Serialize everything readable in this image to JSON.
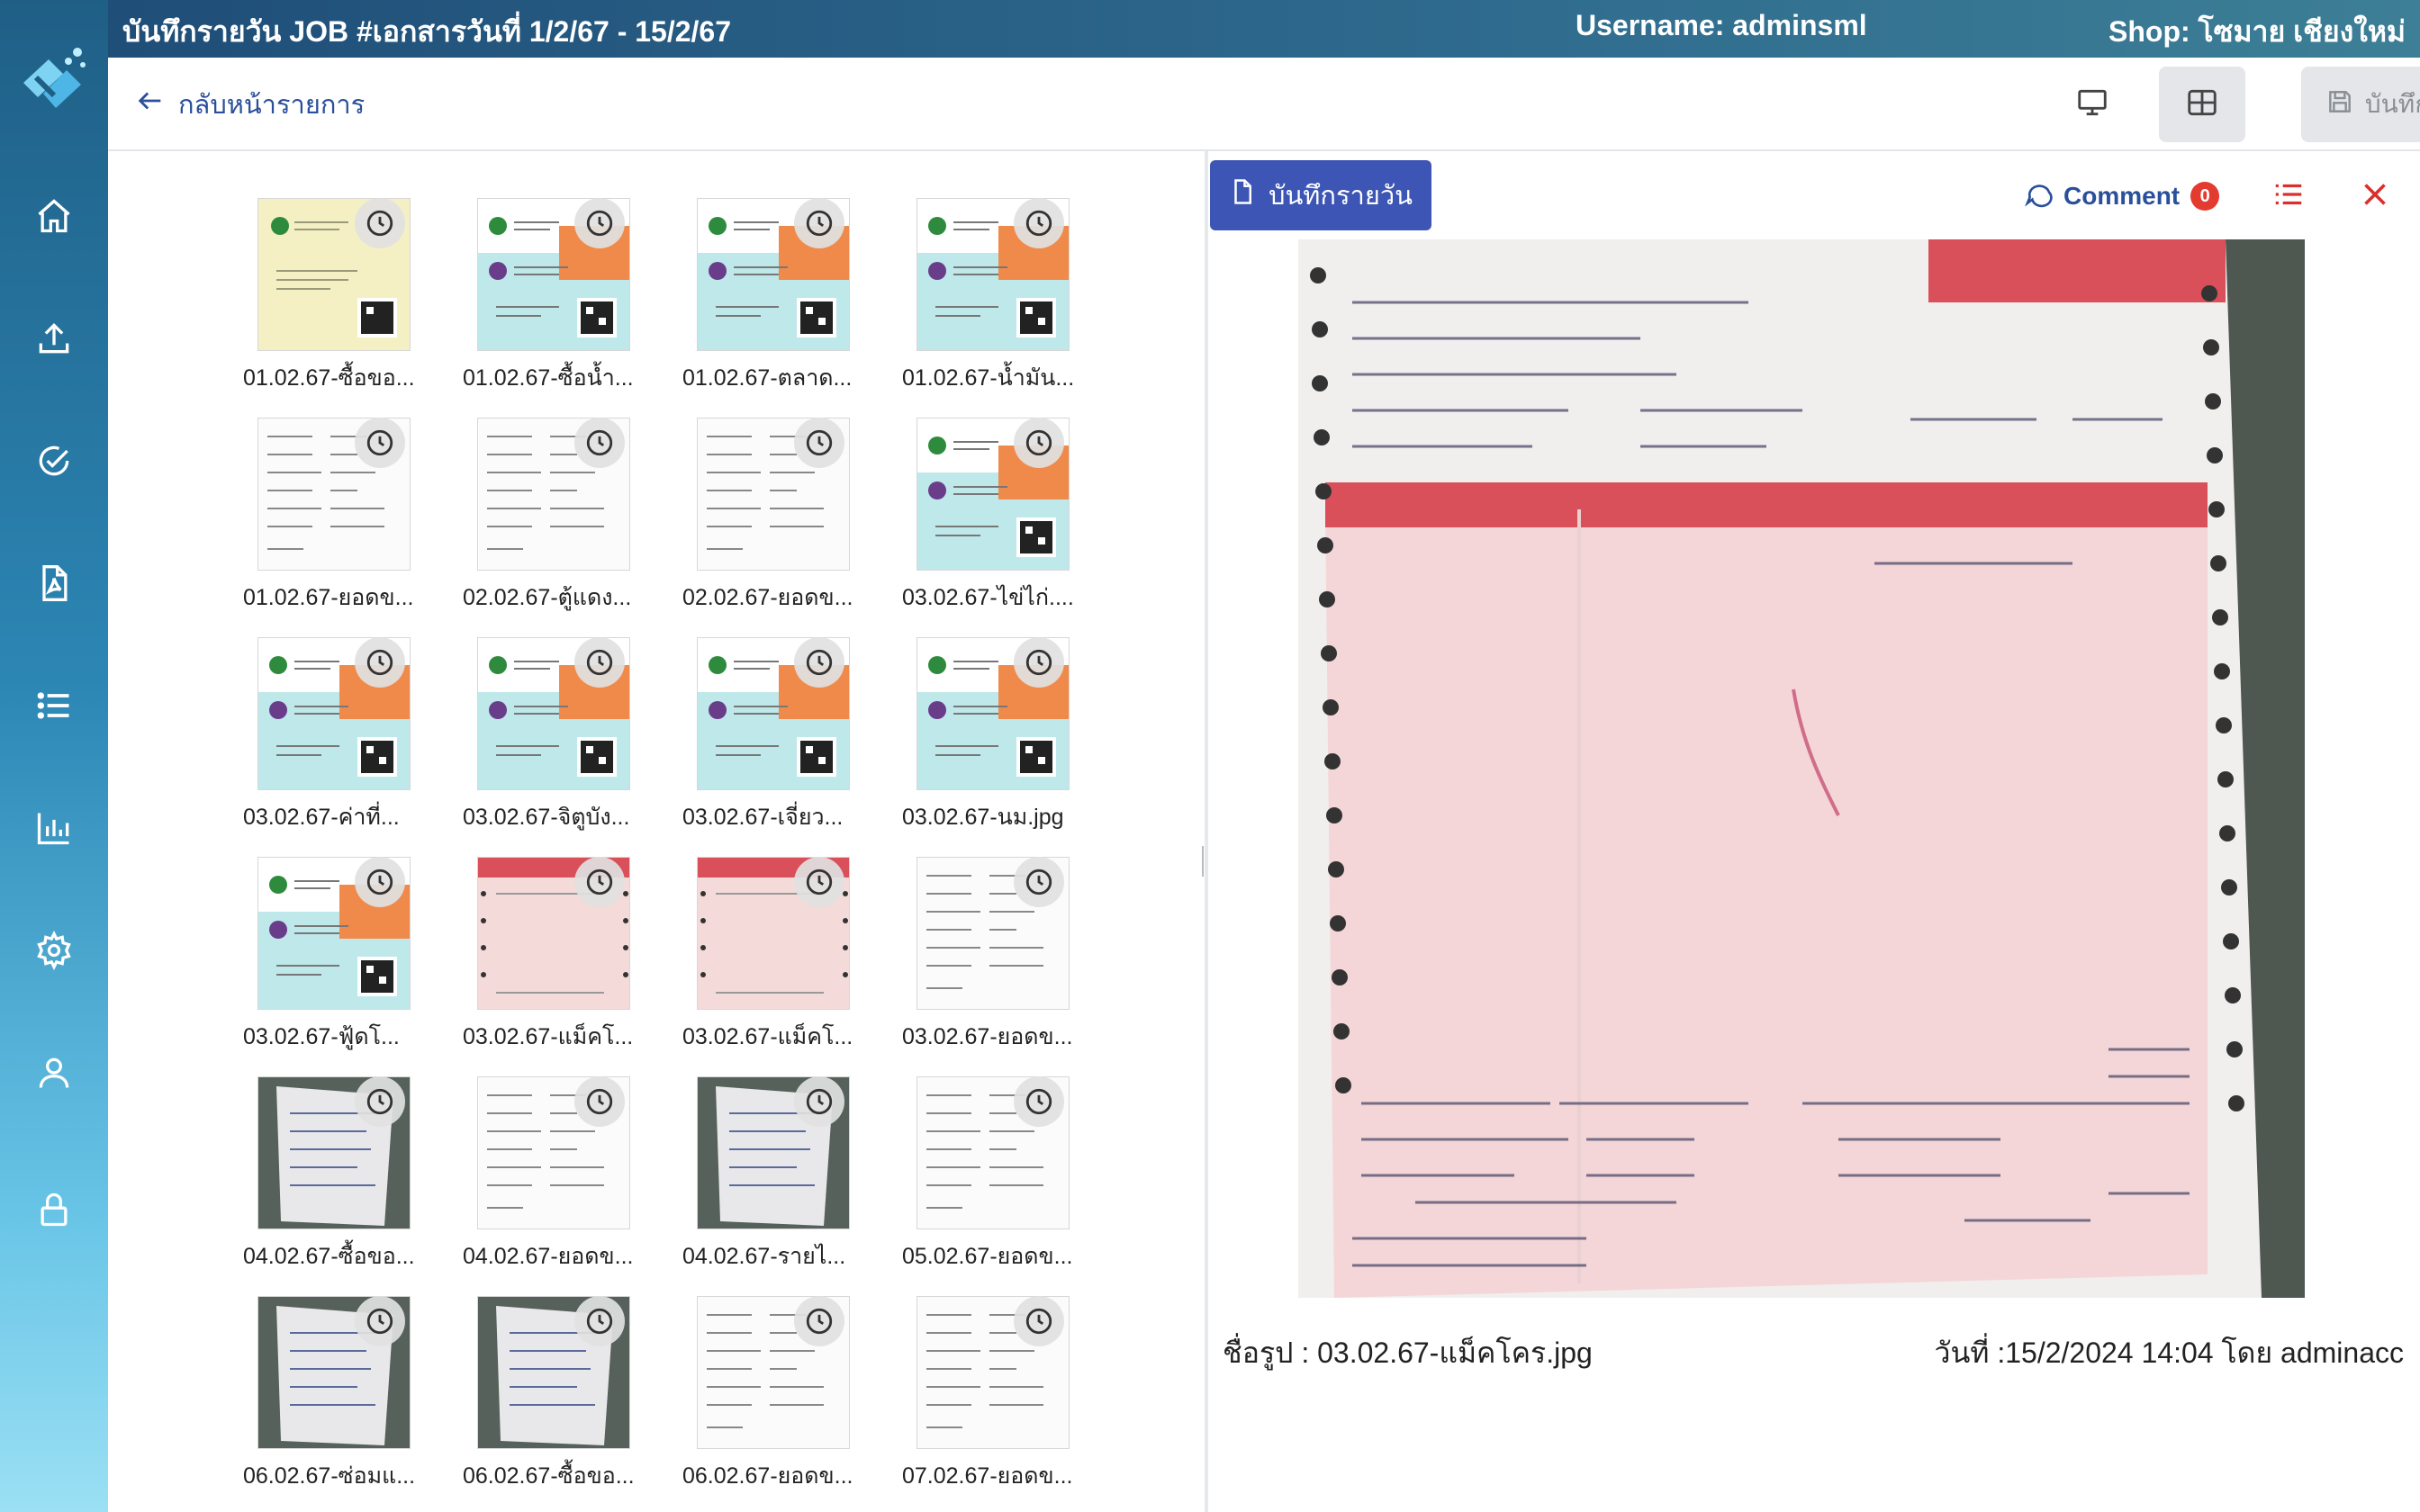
{
  "header": {
    "title": "บันทึกรายวัน JOB #เอกสารวันที่ 1/2/67 - 15/2/67",
    "username_label": "Username: adminsml",
    "shop_label": "Shop: โซมาย เชียงใหม่"
  },
  "toolbar": {
    "back_label": "กลับหน้ารายการ",
    "save_label": "บันทึก"
  },
  "sidebar": {
    "items": [
      {
        "name": "home-icon"
      },
      {
        "name": "upload-icon"
      },
      {
        "name": "check-circle-icon"
      },
      {
        "name": "pdf-file-icon"
      },
      {
        "name": "list-icon"
      },
      {
        "name": "bar-chart-icon"
      },
      {
        "name": "gear-icon"
      },
      {
        "name": "user-icon"
      },
      {
        "name": "lock-icon"
      }
    ]
  },
  "files": [
    {
      "caption": "01.02.67-ซื้อขอ...",
      "kind": "yellow"
    },
    {
      "caption": "01.02.67-ซื้อน้ำ...",
      "kind": "bank"
    },
    {
      "caption": "01.02.67-ตลาด...",
      "kind": "bank"
    },
    {
      "caption": "01.02.67-น้ำมัน...",
      "kind": "bank"
    },
    {
      "caption": "01.02.67-ยอดข...",
      "kind": "paper"
    },
    {
      "caption": "02.02.67-ตู้แดง...",
      "kind": "paper"
    },
    {
      "caption": "02.02.67-ยอดข...",
      "kind": "paper"
    },
    {
      "caption": "03.02.67-ไข่ไก่....",
      "kind": "bank"
    },
    {
      "caption": "03.02.67-ค่าที่...",
      "kind": "bank"
    },
    {
      "caption": "03.02.67-จิตูบัง...",
      "kind": "bank"
    },
    {
      "caption": "03.02.67-เจี่ยว...",
      "kind": "bank"
    },
    {
      "caption": "03.02.67-นม.jpg",
      "kind": "bank"
    },
    {
      "caption": "03.02.67-ฟู้ดโ...",
      "kind": "bank"
    },
    {
      "caption": "03.02.67-แม็คโ...",
      "kind": "pink"
    },
    {
      "caption": "03.02.67-แม็คโ...",
      "kind": "pink"
    },
    {
      "caption": "03.02.67-ยอดข...",
      "kind": "paper"
    },
    {
      "caption": "04.02.67-ซื้อขอ...",
      "kind": "photo"
    },
    {
      "caption": "04.02.67-ยอดข...",
      "kind": "paper"
    },
    {
      "caption": "04.02.67-รายไ...",
      "kind": "photo"
    },
    {
      "caption": "05.02.67-ยอดข...",
      "kind": "paper"
    },
    {
      "caption": "06.02.67-ซ่อมแ...",
      "kind": "photo"
    },
    {
      "caption": "06.02.67-ซื้อขอ...",
      "kind": "photo"
    },
    {
      "caption": "06.02.67-ยอดข...",
      "kind": "paper"
    },
    {
      "caption": "07.02.67-ยอดข...",
      "kind": "paper"
    }
  ],
  "preview": {
    "daily_button": "บันทึกรายวัน",
    "comment_label": "Comment",
    "comment_count": "0",
    "filename": "ชื่อรูป : 03.02.67-แม็คโคร.jpg",
    "timestamp": "วันที่ :15/2/2024 14:04 โดย adminacc"
  },
  "colors": {
    "accent": "#3d55b4",
    "header": "#1f4e78",
    "badge": "#e33b30",
    "close": "#d9302c"
  }
}
